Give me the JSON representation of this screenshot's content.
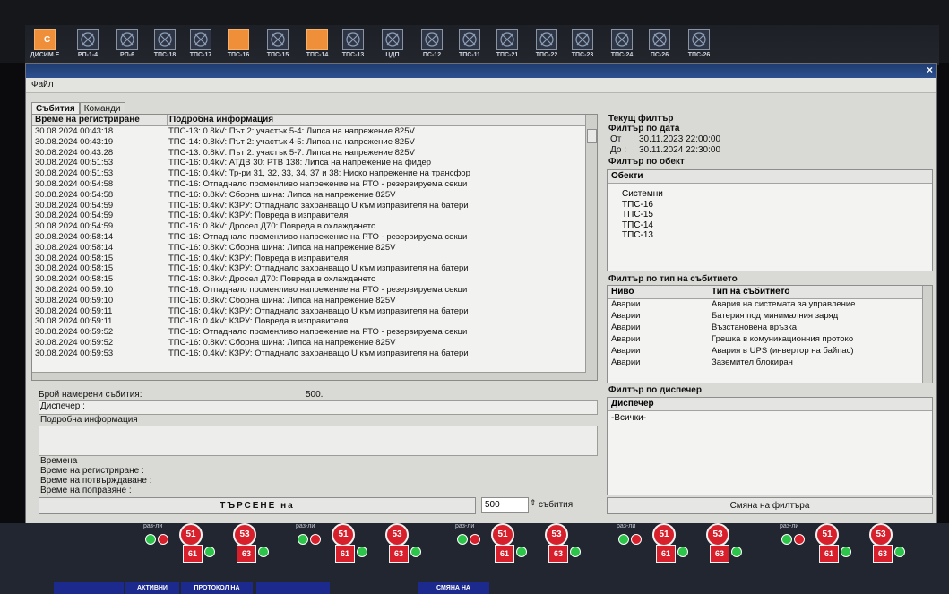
{
  "stations": [
    {
      "label": "ДИСИМ.Е",
      "state": "orange",
      "caption": "С"
    },
    {
      "label": "РП-1-4",
      "state": "off"
    },
    {
      "label": "РП-6",
      "state": "off"
    },
    {
      "label": "ТПС-18",
      "state": "off"
    },
    {
      "label": "ТПС-17",
      "state": "off"
    },
    {
      "label": "ТПС-16",
      "state": "orange"
    },
    {
      "label": "ТПС-15",
      "state": "off"
    },
    {
      "label": "ТПС-14",
      "state": "orange"
    },
    {
      "label": "ТПС-13",
      "state": "off"
    },
    {
      "label": "ЦДП",
      "state": "off"
    },
    {
      "label": "ПС-12",
      "state": "off"
    },
    {
      "label": "ТПС-11",
      "state": "off"
    },
    {
      "label": "ТПС-21",
      "state": "off"
    },
    {
      "label": "ТПС-22",
      "state": "off"
    },
    {
      "label": "ТПС-23",
      "state": "off"
    },
    {
      "label": "ТПС-24",
      "state": "off"
    },
    {
      "label": "ПС-26",
      "state": "off"
    },
    {
      "label": "ТПС-26",
      "state": "off"
    }
  ],
  "window": {
    "menu_file": "Файл",
    "close": "×"
  },
  "tabs": [
    {
      "label": "Събития"
    },
    {
      "label": "Команди"
    }
  ],
  "events": {
    "col_time": "Време на регистриране",
    "col_info": "Подробна информация",
    "rows": [
      [
        "30.08.2024 00:43:18",
        "ТПС-13: 0.8kV: Път 2: участък 5-4: Липса на напрежение 825V"
      ],
      [
        "30.08.2024 00:43:19",
        "ТПС-14: 0.8kV: Път 2: участък 4-5: Липса на напрежение 825V"
      ],
      [
        "30.08.2024 00:43:28",
        "ТПС-13: 0.8kV: Път 2: участък 5-7: Липса на напрежение 825V"
      ],
      [
        "30.08.2024 00:51:53",
        "ТПС-16: 0.4kV: АТДВ 30: РТВ 138: Липса на напрежение на фидер"
      ],
      [
        "30.08.2024 00:51:53",
        "ТПС-16: 0.4kV: Тр-ри 31, 32, 33, 34, 37 и 38: Ниско напрежение на трансфор"
      ],
      [
        "30.08.2024 00:54:58",
        "ТПС-16: Отпаднало променливо напрежение на РТО - резервируема секци"
      ],
      [
        "30.08.2024 00:54:58",
        "ТПС-16: 0.8kV: Сборна шина: Липса на напрежение 825V"
      ],
      [
        "30.08.2024 00:54:59",
        "ТПС-16: 0.4kV: КЗРУ: Отпаднало захранващо U към изправителя на батери"
      ],
      [
        "30.08.2024 00:54:59",
        "ТПС-16: 0.4kV: КЗРУ: Повреда в изправителя"
      ],
      [
        "30.08.2024 00:54:59",
        "ТПС-16: 0.8kV: Дросел Д70: Повреда в охлаждането"
      ],
      [
        "30.08.2024 00:58:14",
        "ТПС-16: Отпаднало променливо напрежение на РТО - резервируема секци"
      ],
      [
        "30.08.2024 00:58:14",
        "ТПС-16: 0.8kV: Сборна шина: Липса на напрежение 825V"
      ],
      [
        "30.08.2024 00:58:15",
        "ТПС-16: 0.4kV: КЗРУ: Повреда в изправителя"
      ],
      [
        "30.08.2024 00:58:15",
        "ТПС-16: 0.4kV: КЗРУ: Отпаднало захранващо U към изправителя на батери"
      ],
      [
        "30.08.2024 00:58:15",
        "ТПС-16: 0.8kV: Дросел Д70: Повреда в охлаждането"
      ],
      [
        "30.08.2024 00:59:10",
        "ТПС-16: Отпаднало променливо напрежение на РТО - резервируема секци"
      ],
      [
        "30.08.2024 00:59:10",
        "ТПС-16: 0.8kV: Сборна шина: Липса на напрежение 825V"
      ],
      [
        "30.08.2024 00:59:11",
        "ТПС-16: 0.4kV: КЗРУ: Отпаднало захранващо U към изправителя на батери"
      ],
      [
        "30.08.2024 00:59:11",
        "ТПС-16: 0.4kV: КЗРУ: Повреда в изправителя"
      ],
      [
        "30.08.2024 00:59:52",
        "ТПС-16: Отпаднало променливо напрежение на РТО - резервируема секци"
      ],
      [
        "30.08.2024 00:59:52",
        "ТПС-16: 0.8kV: Сборна шина: Липса на напрежение 825V"
      ],
      [
        "30.08.2024 00:59:53",
        "ТПС-16: 0.4kV: КЗРУ: Отпаднало захранващо U към изправителя на батери"
      ]
    ]
  },
  "details": {
    "found_label": "Брой намерени събития:",
    "found_value": "500.",
    "dispatcher_label": "Диспечер :",
    "info_label": "Подробна информация",
    "times_label": "Времена",
    "reg_label": "Време на регистриране :",
    "confirm_label": "Време на потвърждаване :",
    "fix_label": "Време на поправяне :"
  },
  "search": {
    "button": "ТЪРСЕНЕ на",
    "count": "500",
    "count_label": "събития"
  },
  "filter": {
    "current": "Текущ филтър",
    "by_date": "Филтър по дата",
    "from_label": "От :",
    "from_value": "30.11.2023 22:00:00",
    "to_label": "До :",
    "to_value": "30.11.2024 22:30:00",
    "by_object": "Филтър по обект",
    "objects_head": "Обекти",
    "objects": [
      "Системни",
      "ТПС-16",
      "ТПС-15",
      "ТПС-14",
      "ТПС-13"
    ],
    "by_type": "Филтър по тип на събитието",
    "type_col_level": "Ниво",
    "type_col_type": "Тип на събитието",
    "types": [
      [
        "Аварии",
        "Авария на системата за управление"
      ],
      [
        "Аварии",
        "Батерия под минималния заряд"
      ],
      [
        "Аварии",
        "Възстановена връзка"
      ],
      [
        "Аварии",
        "Грешка в комуникационния протоко"
      ],
      [
        "Аварии",
        "Авария в UPS (инвертор на байпас)"
      ],
      [
        "Аварии",
        "Заземител блокиран"
      ]
    ],
    "by_dispatcher": "Филтър по диспечер",
    "dispatcher_head": "Диспечер",
    "dispatcher_value": "-Всички-",
    "change_button": "Смяна на филтъра"
  },
  "schematic": {
    "labels": [
      "раз-ли",
      "раз-ли",
      "раз-ли",
      "раз-ли",
      "раз-ли"
    ],
    "c1": "51",
    "c2": "53",
    "sq1": "61",
    "sq2": "63"
  },
  "nav": {
    "b1": "",
    "b2": "АКТИВНИ",
    "b3": "ПРОТОКОЛ НА",
    "b4": "",
    "b5": "СМЯНА НА"
  }
}
